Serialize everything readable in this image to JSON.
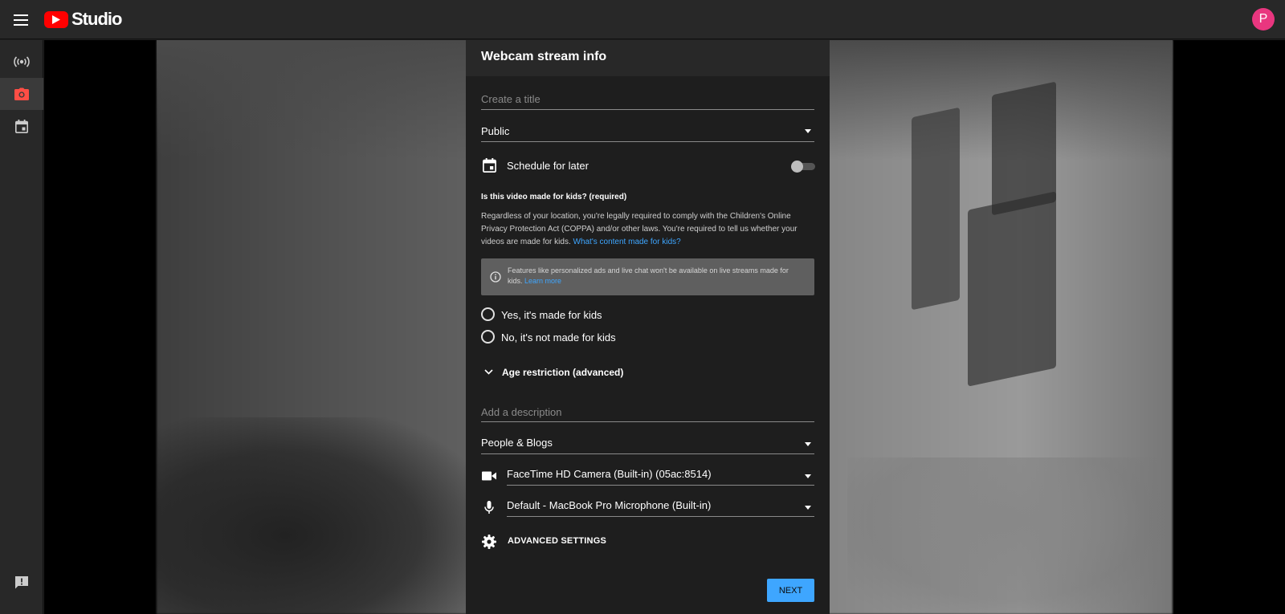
{
  "app": {
    "name": "Studio",
    "avatar_initial": "P",
    "avatar_color": "#e9367f",
    "brand_color": "#ff0000",
    "accent_color": "#3ea6ff"
  },
  "sidebar": {
    "items": [
      {
        "icon": "live-stream-icon",
        "active": false
      },
      {
        "icon": "webcam-icon",
        "active": true
      },
      {
        "icon": "calendar-icon",
        "active": false
      }
    ],
    "bottom_icon": "feedback-icon"
  },
  "panel": {
    "title": "Webcam stream info",
    "title_placeholder": "Create a title",
    "visibility": "Public",
    "schedule_label": "Schedule for later",
    "schedule_enabled": false,
    "kids": {
      "heading": "Is this video made for kids? (required)",
      "description": "Regardless of your location, you're legally required to comply with the Children's Online Privacy Protection Act (COPPA) and/or other laws. You're required to tell us whether your videos are made for kids.",
      "link": "What's content made for kids?",
      "info_text": "Features like personalized ads and live chat won't be available on live streams made for kids.",
      "info_link": "Learn more",
      "option_yes": "Yes, it's made for kids",
      "option_no": "No, it's not made for kids"
    },
    "age_restriction": "Age restriction (advanced)",
    "description_placeholder": "Add a description",
    "category": "People & Blogs",
    "camera": "FaceTime HD Camera (Built-in) (05ac:8514)",
    "microphone": "Default - MacBook Pro Microphone (Built-in)",
    "advanced_settings": "ADVANCED SETTINGS",
    "next_button": "NEXT"
  }
}
